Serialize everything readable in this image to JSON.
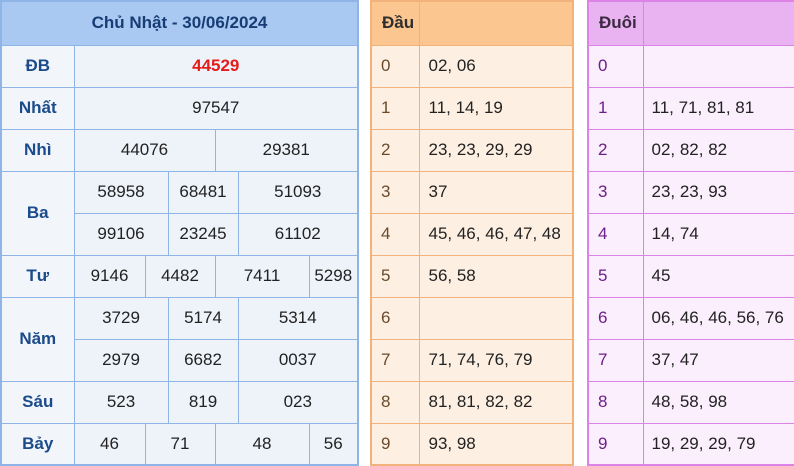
{
  "results": {
    "title": "Chủ Nhật - 30/06/2024",
    "rows": [
      {
        "label": "ĐB",
        "values": [
          "44529"
        ]
      },
      {
        "label": "Nhất",
        "values": [
          "97547"
        ]
      },
      {
        "label": "Nhì",
        "values": [
          "44076",
          "29381"
        ]
      },
      {
        "label": "Ba",
        "values": [
          "58958",
          "68481",
          "51093",
          "99106",
          "23245",
          "61102"
        ]
      },
      {
        "label": "Tư",
        "values": [
          "9146",
          "4482",
          "7411",
          "5298"
        ]
      },
      {
        "label": "Năm",
        "values": [
          "3729",
          "5174",
          "5314",
          "2979",
          "6682",
          "0037"
        ]
      },
      {
        "label": "Sáu",
        "values": [
          "523",
          "819",
          "023"
        ]
      },
      {
        "label": "Bảy",
        "values": [
          "46",
          "71",
          "48",
          "56"
        ]
      }
    ]
  },
  "dau": {
    "header": "Đầu",
    "rows": [
      {
        "digit": "0",
        "values": "02, 06"
      },
      {
        "digit": "1",
        "values": "11, 14, 19"
      },
      {
        "digit": "2",
        "values": "23, 23, 29, 29"
      },
      {
        "digit": "3",
        "values": "37"
      },
      {
        "digit": "4",
        "values": "45, 46, 46, 47, 48"
      },
      {
        "digit": "5",
        "values": "56, 58"
      },
      {
        "digit": "6",
        "values": ""
      },
      {
        "digit": "7",
        "values": "71, 74, 76, 79"
      },
      {
        "digit": "8",
        "values": "81, 81, 82, 82"
      },
      {
        "digit": "9",
        "values": "93, 98"
      }
    ]
  },
  "duoi": {
    "header": "Đuôi",
    "rows": [
      {
        "digit": "0",
        "values": ""
      },
      {
        "digit": "1",
        "values": "11, 71, 81, 81"
      },
      {
        "digit": "2",
        "values": "02, 82, 82"
      },
      {
        "digit": "3",
        "values": "23, 23, 93"
      },
      {
        "digit": "4",
        "values": "14, 74"
      },
      {
        "digit": "5",
        "values": "45"
      },
      {
        "digit": "6",
        "values": "06, 46, 46, 56, 76"
      },
      {
        "digit": "7",
        "values": "37, 47"
      },
      {
        "digit": "8",
        "values": "48, 58, 98"
      },
      {
        "digit": "9",
        "values": "19, 29, 29, 79"
      }
    ]
  },
  "colors": {
    "special_prize": "#e41c1c",
    "results_header": "#a9c8f2",
    "dau_header": "#fbc68f",
    "duoi_header": "#e8b3f0"
  }
}
